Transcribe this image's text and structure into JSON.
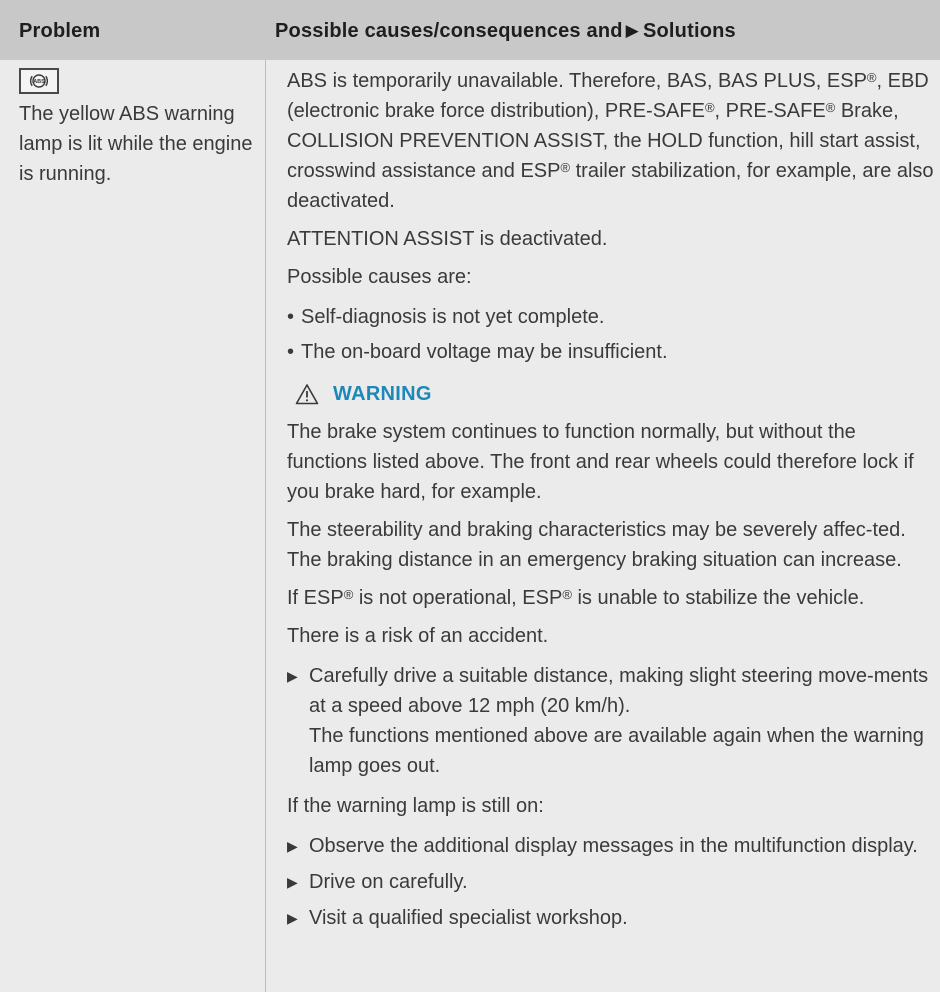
{
  "header": {
    "problem": "Problem",
    "solutions_prefix": "Possible causes/consequences and",
    "solutions_suffix": "Solutions"
  },
  "problem": {
    "icon": "abs-warning-lamp-icon",
    "text": "The yellow ABS warning lamp is lit while the engine is running."
  },
  "content": {
    "p1_a": "ABS is temporarily unavailable. Therefore, BAS, BAS PLUS, ESP",
    "p1_b": ", EBD (electronic brake force distribution), PRE-SAFE",
    "p1_c": ", PRE-SAFE",
    "p1_d": " Brake, COLLISION PREVENTION ASSIST, the HOLD function, hill start assist, crosswind assistance and ESP",
    "p1_e": " trailer stabilization, for example, are also deactivated.",
    "reg": "®",
    "p2": "ATTENTION ASSIST is deactivated.",
    "p3": "Possible causes are:",
    "causes": [
      "Self-diagnosis is not yet complete.",
      "The on-board voltage may be insufficient."
    ],
    "warning_label": "WARNING",
    "w1": "The brake system continues to function normally, but without the functions listed above. The front and rear wheels could therefore lock if you brake hard, for example.",
    "w2": "The steerability and braking characteristics may be severely affec-ted. The braking distance in an emergency braking situation can increase.",
    "w3_a": "If ESP",
    "w3_b": " is not operational, ESP",
    "w3_c": " is unable to stabilize the vehicle.",
    "w4": "There is a risk of an accident.",
    "step1": "Carefully drive a suitable distance, making slight steering move-ments at a speed above 12 mph (20 km/h).",
    "step1_note": "The functions mentioned above are available again when the warning lamp goes out.",
    "p_still": "If the warning lamp is still on:",
    "steps2": [
      "Observe the additional display messages in the multifunction display.",
      "Drive on carefully.",
      "Visit a qualified specialist workshop."
    ]
  },
  "colors": {
    "header_bg": "#c8c8c8",
    "cell_bg": "#ebebeb",
    "warning_accent": "#1d87b8"
  }
}
